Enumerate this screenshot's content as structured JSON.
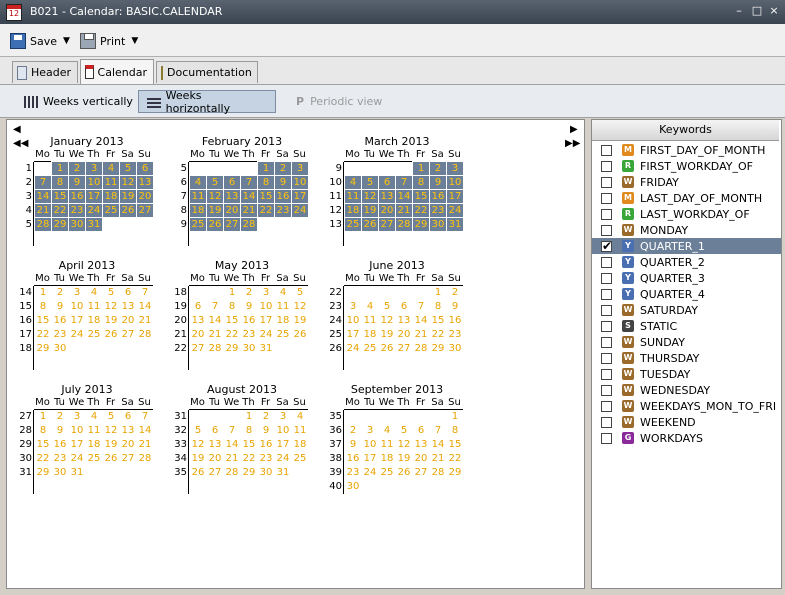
{
  "window": {
    "title": "B021 - Calendar: BASIC.CALENDAR",
    "app_icon_text": "12",
    "minimize": "–",
    "maximize": "□",
    "close": "×"
  },
  "toolbar": {
    "save_label": "Save",
    "print_label": "Print",
    "dropdown_caret": "▼"
  },
  "tabs": [
    {
      "label": "Header",
      "icon": "header-icon",
      "active": false
    },
    {
      "label": "Calendar",
      "icon": "calendar-icon",
      "active": true
    },
    {
      "label": "Documentation",
      "icon": "document-icon",
      "active": false
    }
  ],
  "view_buttons": [
    {
      "label": "Weeks vertically",
      "active": false,
      "disabled": false
    },
    {
      "label": "Weeks horizontally",
      "active": true,
      "disabled": false
    },
    {
      "label": "Periodic view",
      "active": false,
      "disabled": true,
      "icon_text": "P"
    }
  ],
  "nav": {
    "prev": "◀",
    "prev_fast": "◀◀",
    "next": "▶",
    "next_fast": "▶▶"
  },
  "weekday_headers": [
    "Mo",
    "Tu",
    "We",
    "Th",
    "Fr",
    "Sa",
    "Su"
  ],
  "colors": {
    "selected_cell": "#6b7f98",
    "day_text": "#e8a400",
    "selected_day_text": "#ffc40a",
    "titlebar": "#3a4450"
  },
  "months": [
    {
      "title": "January 2013",
      "first_weekday": 1,
      "days": 31,
      "weeks": [
        "1",
        "2",
        "3",
        "4",
        "5"
      ],
      "selected": true
    },
    {
      "title": "February 2013",
      "first_weekday": 4,
      "days": 28,
      "weeks": [
        "5",
        "6",
        "7",
        "8",
        "9"
      ],
      "selected": true
    },
    {
      "title": "March 2013",
      "first_weekday": 4,
      "days": 31,
      "weeks": [
        "9",
        "10",
        "11",
        "12",
        "13"
      ],
      "selected": true
    },
    {
      "title": "April 2013",
      "first_weekday": 0,
      "days": 30,
      "weeks": [
        "14",
        "15",
        "16",
        "17",
        "18"
      ],
      "selected": false
    },
    {
      "title": "May 2013",
      "first_weekday": 2,
      "days": 31,
      "weeks": [
        "18",
        "19",
        "20",
        "21",
        "22"
      ],
      "selected": false
    },
    {
      "title": "June 2013",
      "first_weekday": 5,
      "days": 30,
      "weeks": [
        "22",
        "23",
        "24",
        "25",
        "26"
      ],
      "selected": false
    },
    {
      "title": "July 2013",
      "first_weekday": 0,
      "days": 31,
      "weeks": [
        "27",
        "28",
        "29",
        "30",
        "31"
      ],
      "selected": false
    },
    {
      "title": "August 2013",
      "first_weekday": 3,
      "days": 31,
      "weeks": [
        "31",
        "32",
        "33",
        "34",
        "35"
      ],
      "selected": false
    },
    {
      "title": "September 2013",
      "first_weekday": 6,
      "days": 30,
      "weeks": [
        "35",
        "36",
        "37",
        "38",
        "39",
        "40"
      ],
      "selected": false
    }
  ],
  "keywords_header": "Keywords",
  "keywords": [
    {
      "label": "FIRST_DAY_OF_MONTH",
      "icon_letter": "M",
      "icon_color": "#e08a1e",
      "checked": false,
      "selected": false
    },
    {
      "label": "FIRST_WORKDAY_OF",
      "icon_letter": "R",
      "icon_color": "#3aa63a",
      "checked": false,
      "selected": false
    },
    {
      "label": "FRIDAY",
      "icon_letter": "W",
      "icon_color": "#9a6a2a",
      "checked": false,
      "selected": false
    },
    {
      "label": "LAST_DAY_OF_MONTH",
      "icon_letter": "M",
      "icon_color": "#e08a1e",
      "checked": false,
      "selected": false
    },
    {
      "label": "LAST_WORKDAY_OF",
      "icon_letter": "R",
      "icon_color": "#3aa63a",
      "checked": false,
      "selected": false
    },
    {
      "label": "MONDAY",
      "icon_letter": "W",
      "icon_color": "#9a6a2a",
      "checked": false,
      "selected": false
    },
    {
      "label": "QUARTER_1",
      "icon_letter": "Y",
      "icon_color": "#4a6fb0",
      "checked": true,
      "selected": true
    },
    {
      "label": "QUARTER_2",
      "icon_letter": "Y",
      "icon_color": "#4a6fb0",
      "checked": false,
      "selected": false
    },
    {
      "label": "QUARTER_3",
      "icon_letter": "Y",
      "icon_color": "#4a6fb0",
      "checked": false,
      "selected": false
    },
    {
      "label": "QUARTER_4",
      "icon_letter": "Y",
      "icon_color": "#4a6fb0",
      "checked": false,
      "selected": false
    },
    {
      "label": "SATURDAY",
      "icon_letter": "W",
      "icon_color": "#9a6a2a",
      "checked": false,
      "selected": false
    },
    {
      "label": "STATIC",
      "icon_letter": "S",
      "icon_color": "#444444",
      "checked": false,
      "selected": false
    },
    {
      "label": "SUNDAY",
      "icon_letter": "W",
      "icon_color": "#9a6a2a",
      "checked": false,
      "selected": false
    },
    {
      "label": "THURSDAY",
      "icon_letter": "W",
      "icon_color": "#9a6a2a",
      "checked": false,
      "selected": false
    },
    {
      "label": "TUESDAY",
      "icon_letter": "W",
      "icon_color": "#9a6a2a",
      "checked": false,
      "selected": false
    },
    {
      "label": "WEDNESDAY",
      "icon_letter": "W",
      "icon_color": "#9a6a2a",
      "checked": false,
      "selected": false
    },
    {
      "label": "WEEKDAYS_MON_TO_FRI",
      "icon_letter": "W",
      "icon_color": "#9a6a2a",
      "checked": false,
      "selected": false
    },
    {
      "label": "WEEKEND",
      "icon_letter": "W",
      "icon_color": "#9a6a2a",
      "checked": false,
      "selected": false
    },
    {
      "label": "WORKDAYS",
      "icon_letter": "G",
      "icon_color": "#8a2a9a",
      "checked": false,
      "selected": false
    }
  ]
}
